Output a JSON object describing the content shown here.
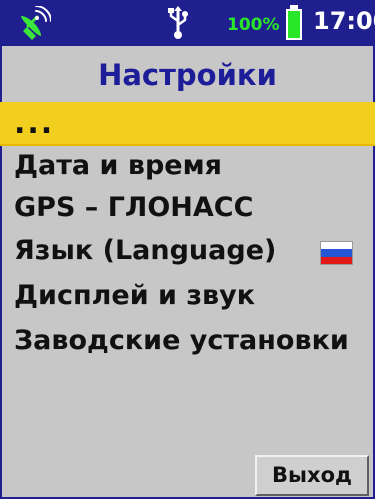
{
  "status_bar": {
    "satellite_icon": "satellite-dish-icon",
    "usb_icon": "usb-icon",
    "battery_percent": "100%",
    "battery_level": 1,
    "battery_icon": "battery-icon",
    "time": "17:00",
    "background_color": "#1f1f8f",
    "accent_color": "#29e629"
  },
  "screen": {
    "title": "Настройки",
    "background_color": "#c7c7c7",
    "title_color": "#1d1d9a",
    "selected_color": "#f2cf1f"
  },
  "menu": {
    "selected_index": 0,
    "items": [
      {
        "label": "..."
      },
      {
        "label": "Дата и время"
      },
      {
        "label": "GPS – ГЛОНАСС"
      },
      {
        "label": "Язык (Language)",
        "icon": "russian-flag-icon"
      },
      {
        "label": "Дисплей и звук"
      },
      {
        "label": "Заводские установки"
      }
    ]
  },
  "actions": {
    "exit_label": "Выход"
  }
}
